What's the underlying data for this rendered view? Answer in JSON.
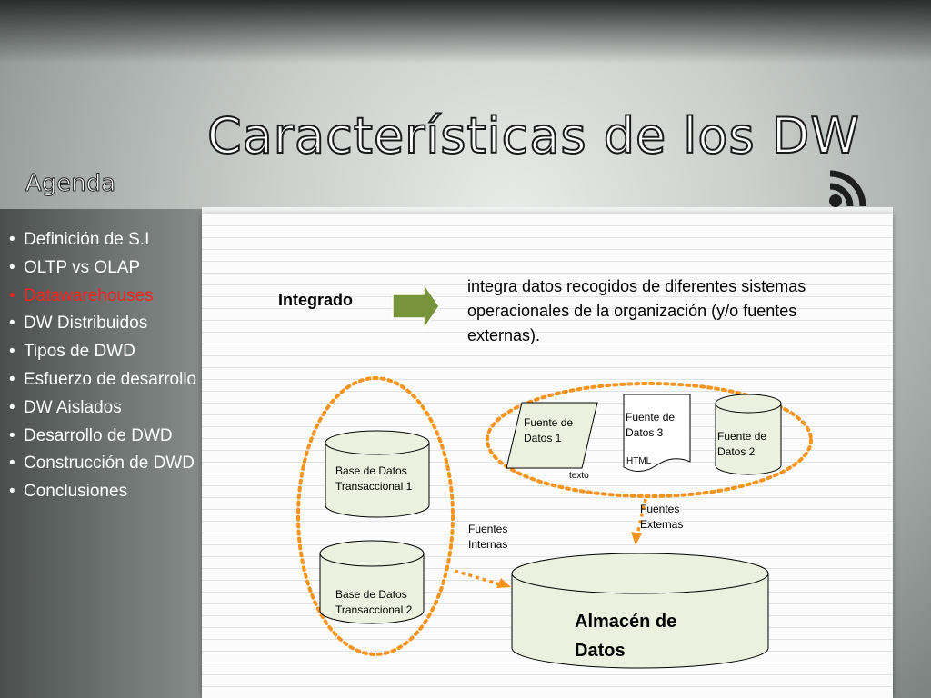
{
  "slide": {
    "title": "Características de los DW",
    "agenda_title": "Agenda",
    "agenda_items": [
      {
        "label": "Definición de S.I",
        "active": false
      },
      {
        "label": "OLTP vs OLAP",
        "active": false
      },
      {
        "label": "Datawarehouses",
        "active": true
      },
      {
        "label": "DW Distribuidos",
        "active": false
      },
      {
        "label": "Tipos de DWD",
        "active": false
      },
      {
        "label": "Esfuerzo de desarrollo",
        "active": false
      },
      {
        "label": "DW Aislados",
        "active": false
      },
      {
        "label": "Desarrollo de DWD",
        "active": false
      },
      {
        "label": "Construcción de DWD",
        "active": false
      },
      {
        "label": "Conclusiones",
        "active": false
      }
    ]
  },
  "content": {
    "term": "Integrado",
    "description": "integra datos recogidos de diferentes sistemas operacionales de la organización (y/o fuentes externas)."
  },
  "diagram": {
    "db1": "Base de Datos Transaccional 1",
    "db2": "Base de Datos Transaccional 2",
    "source1": "Fuente de Datos 1",
    "source1_tag": "texto",
    "source3": "Fuente de Datos 3",
    "source3_tag": "HTML",
    "source2": "Fuente de Datos 2",
    "internal_label": "Fuentes Internas",
    "external_label": "Fuentes Externas",
    "warehouse": "Almacén de Datos"
  },
  "colors": {
    "accent_orange": "#f7941d",
    "arrow_green": "#77933c",
    "shape_fill": "#ebf1de",
    "active_item": "#ff2020"
  }
}
